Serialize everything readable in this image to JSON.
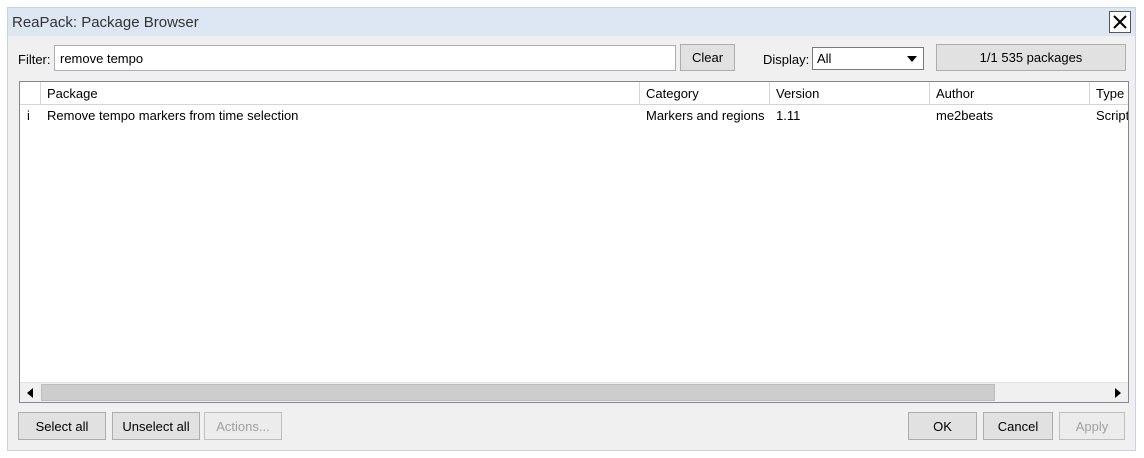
{
  "window": {
    "title": "ReaPack: Package Browser"
  },
  "filter": {
    "label": "Filter:",
    "value": "remove tempo",
    "clear_label": "Clear"
  },
  "display": {
    "label": "Display:",
    "selected": "All"
  },
  "package_count": "1/1 535 packages",
  "table": {
    "columns": [
      "Package",
      "Category",
      "Version",
      "Author",
      "Type"
    ],
    "rows": [
      {
        "state": "i",
        "package": "Remove tempo markers from time selection",
        "category": "Markers and regions",
        "version": "1.11",
        "author": "me2beats",
        "type": "Script"
      }
    ]
  },
  "buttons": {
    "select_all": "Select all",
    "unselect_all": "Unselect all",
    "actions": "Actions...",
    "ok": "OK",
    "cancel": "Cancel",
    "apply": "Apply"
  },
  "icons": {
    "close": "close-icon",
    "dropdown": "chevron-down-icon",
    "scroll_left": "scroll-left-icon",
    "scroll_right": "scroll-right-icon"
  }
}
